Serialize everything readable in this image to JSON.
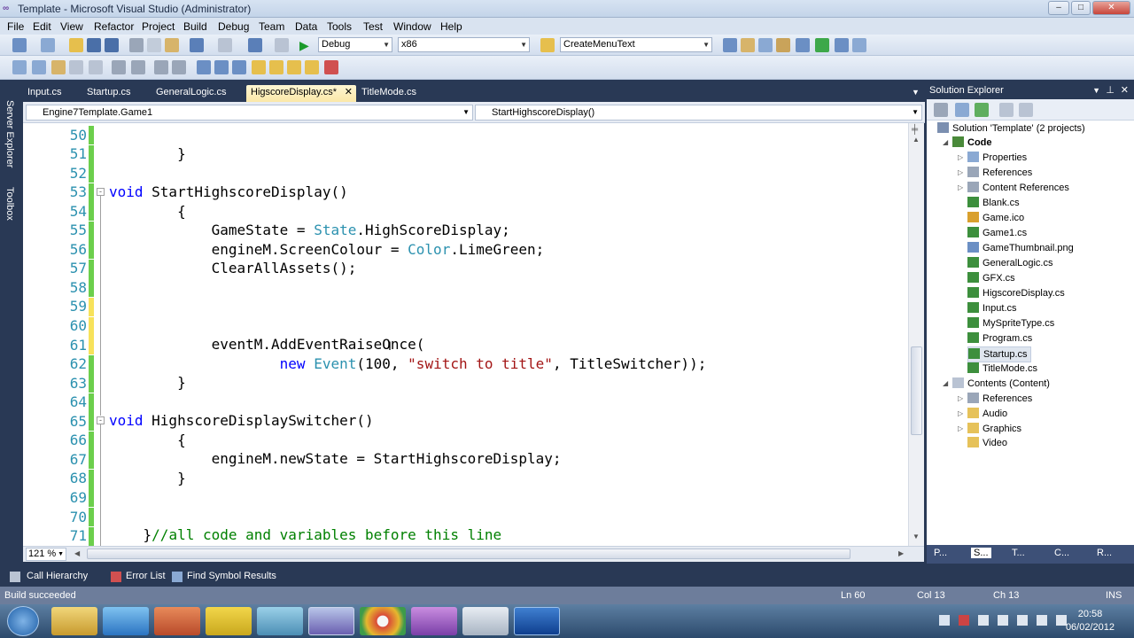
{
  "window": {
    "title": "Template - Microsoft Visual Studio (Administrator)",
    "buttons": [
      "–",
      "□",
      "✕"
    ]
  },
  "menu": [
    "File",
    "Edit",
    "View",
    "Refactor",
    "Project",
    "Build",
    "Debug",
    "Team",
    "Data",
    "Tools",
    "Test",
    "Window",
    "Help"
  ],
  "toolbar": {
    "config": "Debug",
    "platform": "x86",
    "find": "CreateMenuText"
  },
  "tabs": [
    {
      "label": "Input.cs",
      "active": false
    },
    {
      "label": "Startup.cs",
      "active": false
    },
    {
      "label": "GeneralLogic.cs",
      "active": false
    },
    {
      "label": "HigscoreDisplay.cs*",
      "active": true
    },
    {
      "label": "TitleMode.cs",
      "active": false
    }
  ],
  "nav": {
    "type": "Engine7Template.Game1",
    "member": "StartHighscoreDisplay()"
  },
  "left_panels": [
    "Server Explorer",
    "Toolbox"
  ],
  "code": [
    {
      "n": "50",
      "mark": "g"
    },
    {
      "n": "51",
      "mark": "g"
    },
    {
      "n": "52",
      "mark": "g"
    },
    {
      "n": "53",
      "mark": "g"
    },
    {
      "n": "54",
      "mark": "g"
    },
    {
      "n": "55",
      "mark": "g"
    },
    {
      "n": "56",
      "mark": "g"
    },
    {
      "n": "57",
      "mark": "g"
    },
    {
      "n": "58",
      "mark": "g"
    },
    {
      "n": "59",
      "mark": "y"
    },
    {
      "n": "60",
      "mark": "y"
    },
    {
      "n": "61",
      "mark": "y"
    },
    {
      "n": "62",
      "mark": "g"
    },
    {
      "n": "63",
      "mark": "g"
    },
    {
      "n": "64",
      "mark": "g"
    },
    {
      "n": "65",
      "mark": "g"
    },
    {
      "n": "66",
      "mark": "g"
    },
    {
      "n": "67",
      "mark": "g"
    },
    {
      "n": "68",
      "mark": "g"
    },
    {
      "n": "69",
      "mark": "g"
    },
    {
      "n": "70",
      "mark": "g"
    },
    {
      "n": "71",
      "mark": "g"
    }
  ],
  "code_text": {
    "l51": "        }",
    "l53_kw": "void",
    "l53_rest": " StartHighscoreDisplay()",
    "l54": "        {",
    "l55_a": "            GameState = ",
    "l55_t": "State",
    "l55_b": ".HighScoreDisplay;",
    "l56_a": "            engineM.ScreenColour = ",
    "l56_t": "Color",
    "l56_b": ".LimeGreen;",
    "l57": "            ClearAllAssets();",
    "l61": "            eventM.AddEventRaiseOnce(",
    "l62_kw": "new",
    "l62_t": "Event",
    "l62_a": "(100, ",
    "l62_s": "\"switch to title\"",
    "l62_b": ", TitleSwitcher));",
    "l63": "        }",
    "l65_kw": "void",
    "l65_rest": " HighscoreDisplaySwitcher()",
    "l66": "        {",
    "l67": "            engineM.newState = StartHighscoreDisplay;",
    "l68": "        }",
    "l71_a": "    }",
    "l71_c": "//all code and variables before this line"
  },
  "zoom": "121 %",
  "solution_explorer": {
    "title": "Solution Explorer",
    "nodes": [
      {
        "label": "Solution 'Template' (2 projects)",
        "indent": 0,
        "icon": "solution",
        "exp": ""
      },
      {
        "label": "Code",
        "indent": 1,
        "icon": "project",
        "exp": "open",
        "bold": true
      },
      {
        "label": "Properties",
        "indent": 2,
        "icon": "props",
        "exp": "closed"
      },
      {
        "label": "References",
        "indent": 2,
        "icon": "refs",
        "exp": "closed"
      },
      {
        "label": "Content References",
        "indent": 2,
        "icon": "refs",
        "exp": "closed"
      },
      {
        "label": "Blank.cs",
        "indent": 2,
        "icon": "cs",
        "exp": ""
      },
      {
        "label": "Game.ico",
        "indent": 2,
        "icon": "ico",
        "exp": ""
      },
      {
        "label": "Game1.cs",
        "indent": 2,
        "icon": "cs",
        "exp": ""
      },
      {
        "label": "GameThumbnail.png",
        "indent": 2,
        "icon": "png",
        "exp": ""
      },
      {
        "label": "GeneralLogic.cs",
        "indent": 2,
        "icon": "cs",
        "exp": ""
      },
      {
        "label": "GFX.cs",
        "indent": 2,
        "icon": "cs",
        "exp": ""
      },
      {
        "label": "HigscoreDisplay.cs",
        "indent": 2,
        "icon": "cs",
        "exp": ""
      },
      {
        "label": "Input.cs",
        "indent": 2,
        "icon": "cs",
        "exp": ""
      },
      {
        "label": "MySpriteType.cs",
        "indent": 2,
        "icon": "cs",
        "exp": ""
      },
      {
        "label": "Program.cs",
        "indent": 2,
        "icon": "cs",
        "exp": ""
      },
      {
        "label": "Startup.cs",
        "indent": 2,
        "icon": "cs",
        "exp": "",
        "selected": true
      },
      {
        "label": "TitleMode.cs",
        "indent": 2,
        "icon": "cs",
        "exp": ""
      },
      {
        "label": "Contents (Content)",
        "indent": 1,
        "icon": "content",
        "exp": "open"
      },
      {
        "label": "References",
        "indent": 2,
        "icon": "refs",
        "exp": "closed"
      },
      {
        "label": "Audio",
        "indent": 2,
        "icon": "folder",
        "exp": "closed"
      },
      {
        "label": "Graphics",
        "indent": 2,
        "icon": "folder",
        "exp": "closed"
      },
      {
        "label": "Video",
        "indent": 2,
        "icon": "folder",
        "exp": ""
      }
    ],
    "tabs": [
      "P...",
      "S...",
      "T...",
      "C...",
      "R..."
    ]
  },
  "bottom_tabs": [
    "Call Hierarchy",
    "Error List",
    "Find Symbol Results"
  ],
  "status": {
    "message": "Build succeeded",
    "ln": "Ln 60",
    "col": "Col 13",
    "ch": "Ch 13",
    "mode": "INS"
  },
  "clock": {
    "time": "20:58",
    "date": "06/02/2012"
  },
  "colors": {
    "keyword": "#0000ff",
    "type": "#2b91af",
    "string": "#a31515",
    "comment": "#008000",
    "change_saved": "#6ccf4c",
    "change_unsaved": "#f7e25b"
  }
}
